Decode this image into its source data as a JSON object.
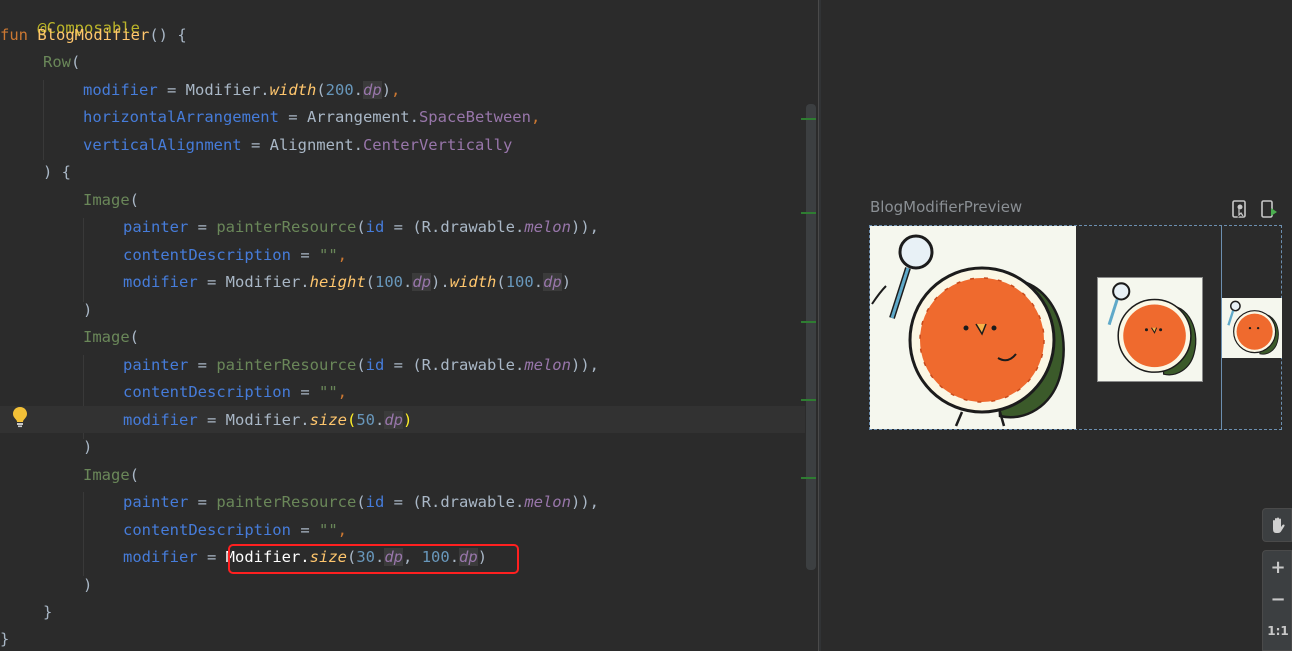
{
  "editor": {
    "annotation": "@Composable",
    "kw_fun": "fun",
    "fun_name": "BlogModifier",
    "fun_tail": "() {",
    "row_call": "Row",
    "paren_open": "(",
    "args": {
      "modifier": "modifier",
      "eq": " = ",
      "modifier_obj": "Modifier.",
      "width": "width",
      "width_val": "200",
      "horizontal": "horizontalArrangement",
      "arrangement": "Arrangement.",
      "space_between": "SpaceBetween",
      "vertical": "verticalAlignment",
      "alignment": "Alignment.",
      "center_vertically": "CenterVertically"
    },
    "row_close": ") {",
    "image_call": "Image",
    "painter": "painter",
    "painter_resource": "painterResource",
    "id_param": "id",
    "r_drawable": "(R.drawable.",
    "melon": "melon",
    "painter_tail": ")),",
    "content_description": "contentDescription",
    "empty_str": "\"\"",
    "comma": ",",
    "dot": ".",
    "dp": "dp",
    "height": "height",
    "size": "size",
    "n100": "100",
    "n50": "50",
    "n30": "30",
    "sep": ", ",
    "close_paren": ")",
    "close_brace": "}"
  },
  "preview": {
    "title": "BlogModifierPreview"
  },
  "zoom": {
    "zoom_in": "+",
    "zoom_out": "−",
    "actual_size": "1:1"
  }
}
